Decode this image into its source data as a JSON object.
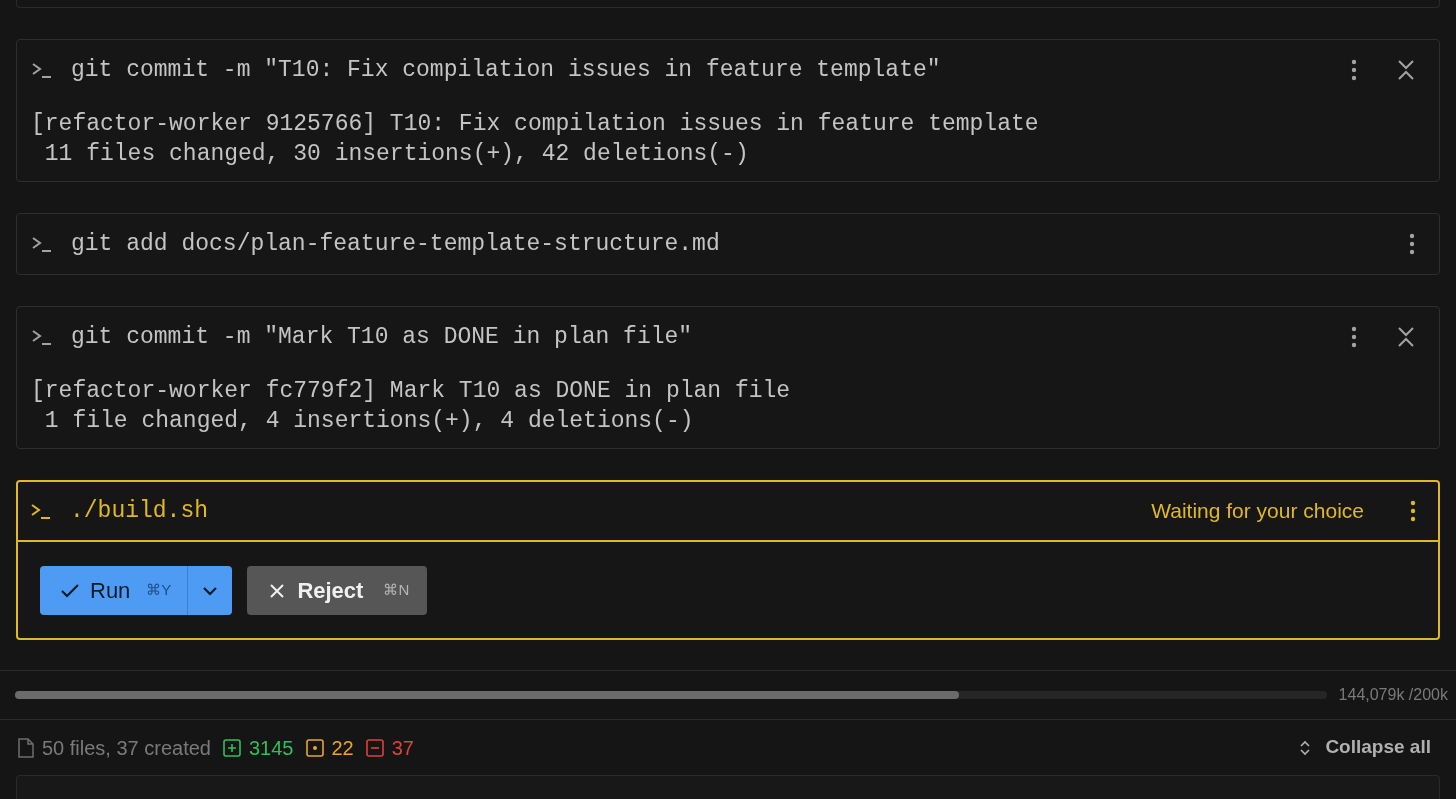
{
  "commands": [
    {
      "command": "git commit -m \"T10: Fix compilation issues in feature template\"",
      "collapsible": true,
      "output": [
        "[refactor-worker 9125766] T10: Fix compilation issues in feature template",
        " 11 files changed, 30 insertions(+), 42 deletions(-)"
      ]
    },
    {
      "command": "git add docs/plan-feature-template-structure.md",
      "collapsible": false
    },
    {
      "command": "git commit -m \"Mark T10 as DONE in plan file\"",
      "collapsible": true,
      "output": [
        "[refactor-worker fc779f2] Mark T10 as DONE in plan file",
        " 1 file changed, 4 insertions(+), 4 deletions(-)"
      ]
    }
  ],
  "pending": {
    "command": "./build.sh",
    "status": "Waiting for your choice",
    "run": {
      "label": "Run",
      "shortcut": "⌘Y"
    },
    "reject": {
      "label": "Reject",
      "shortcut": "⌘N"
    }
  },
  "context": {
    "level": 0.72,
    "reading": "144,079k /200k"
  },
  "footer": {
    "summary": "50 files, 37 created",
    "added": "3145",
    "modified": "22",
    "deleted": "37",
    "collapse": "Collapse all"
  }
}
